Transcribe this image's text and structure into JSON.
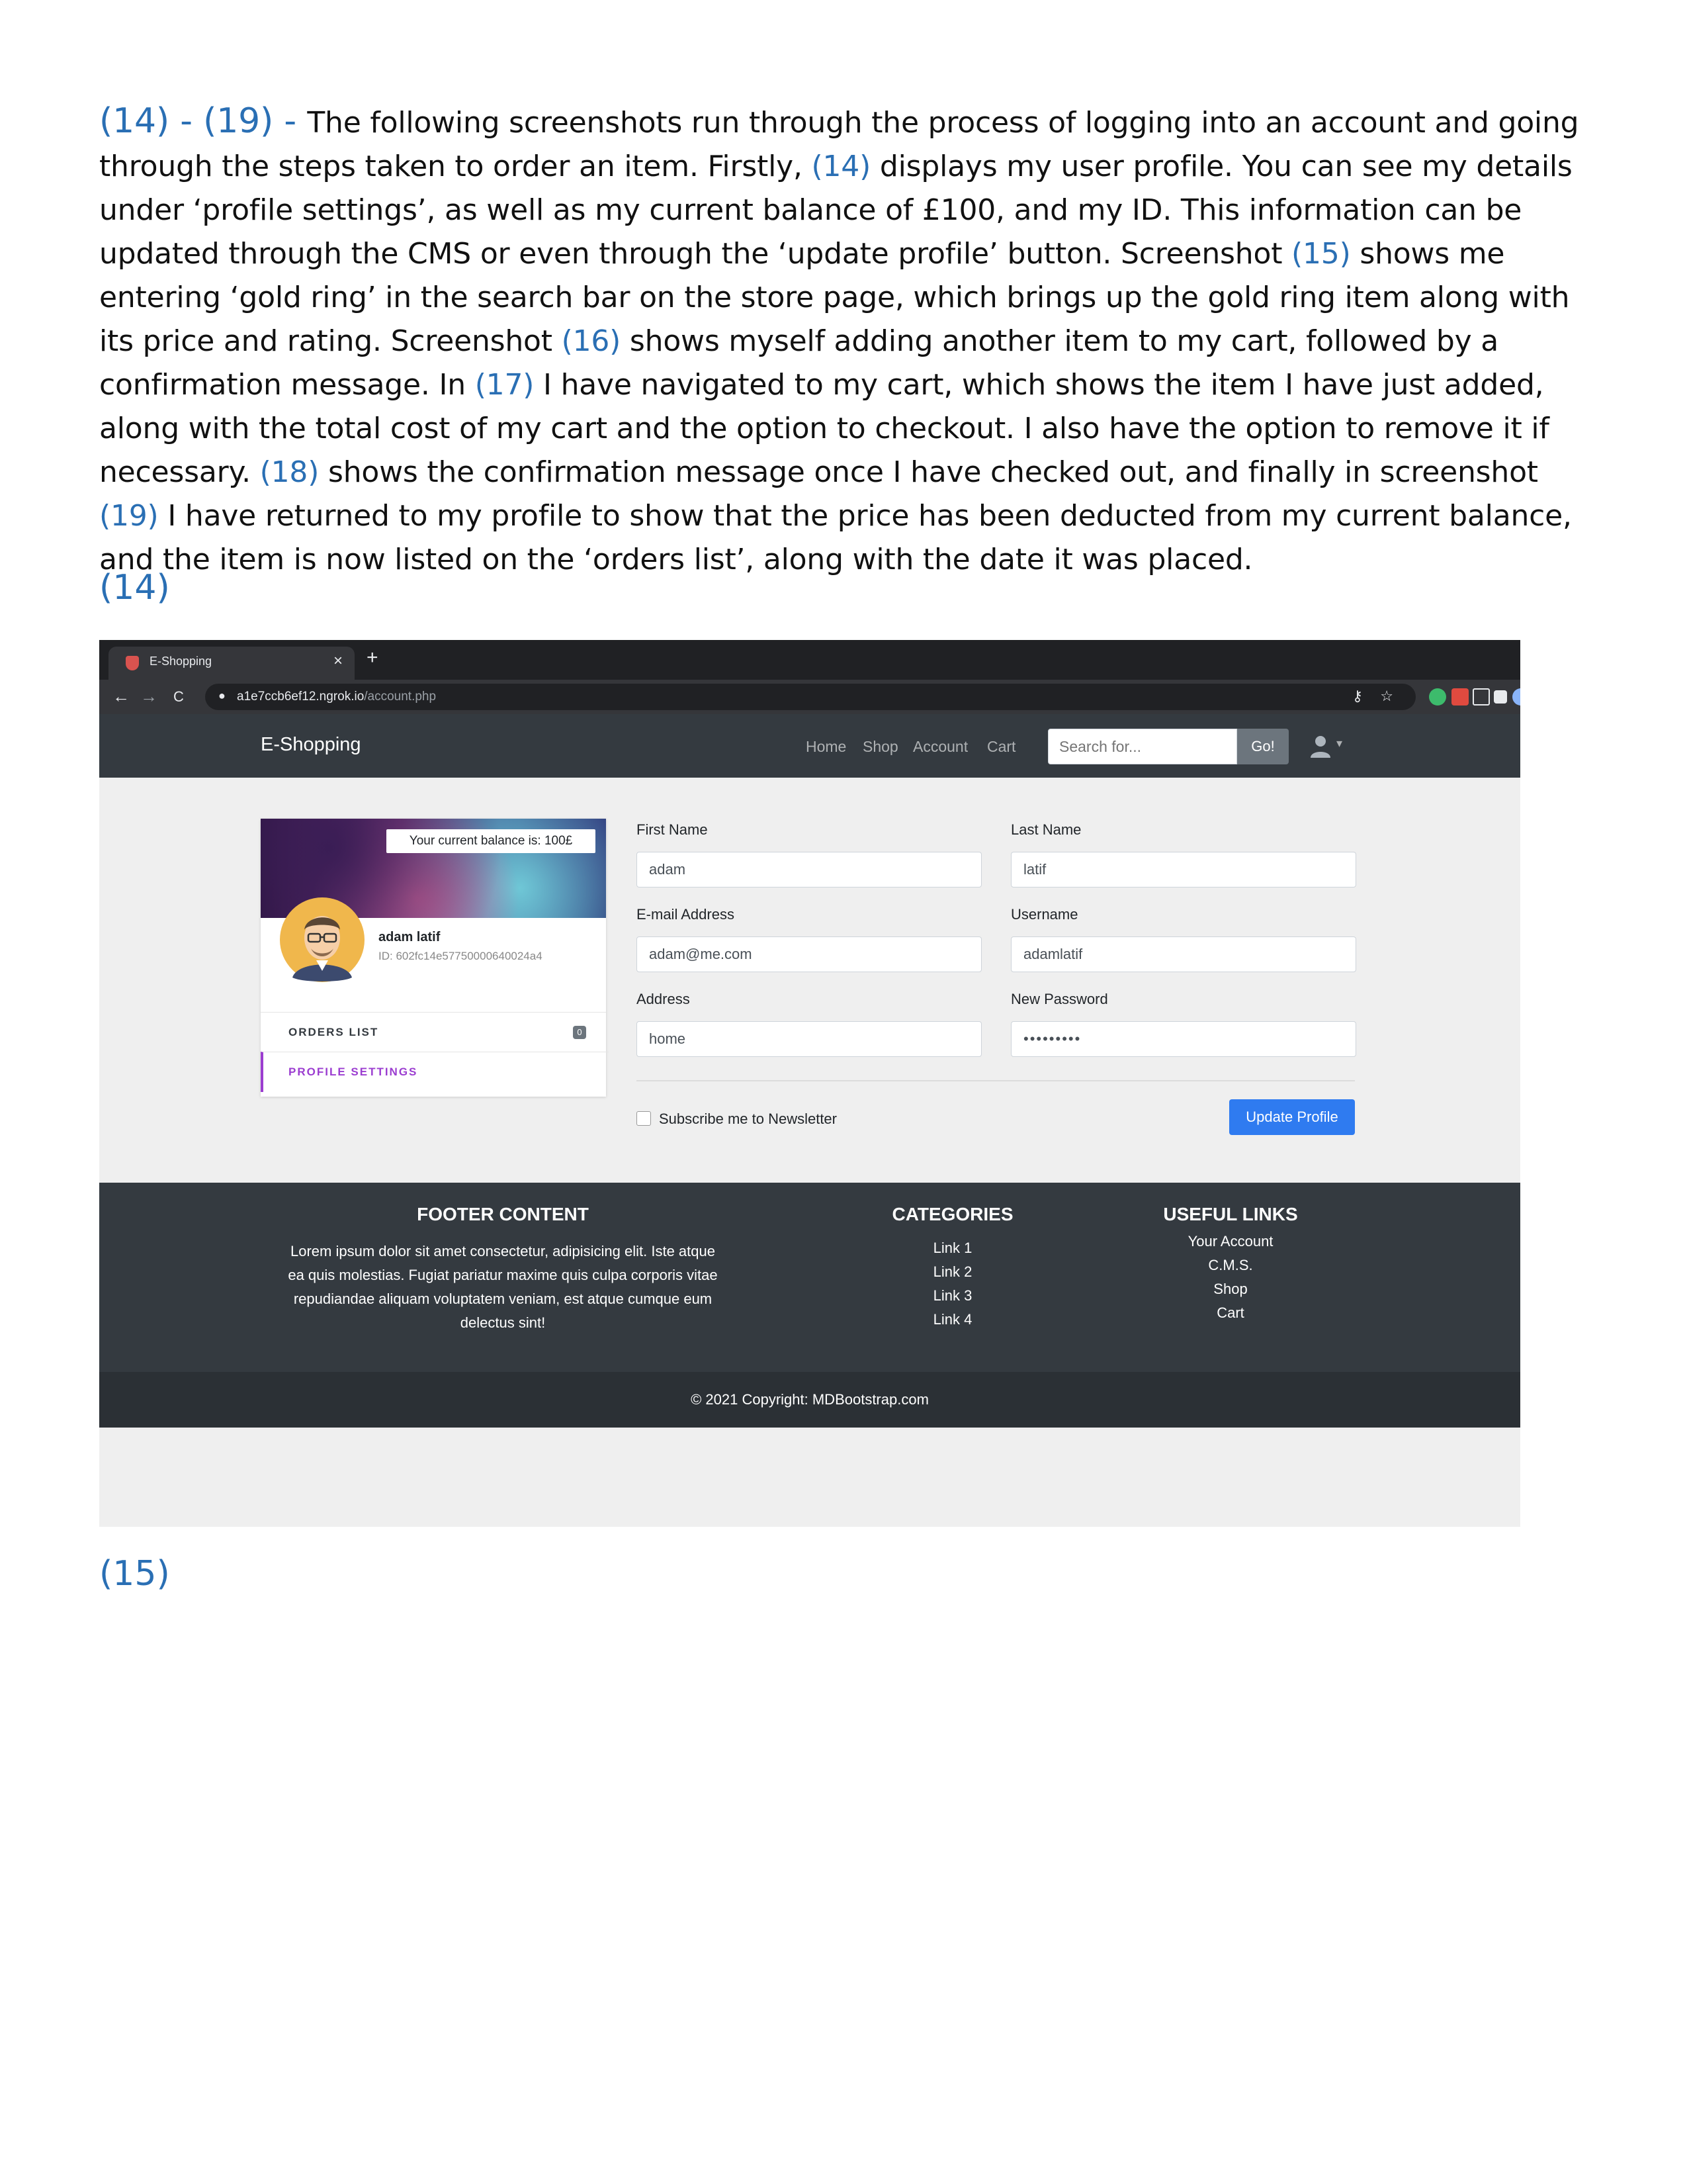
{
  "document": {
    "paragraph_parts": [
      {
        "text": "(14) - (19) - ",
        "ref": true,
        "lead": true
      },
      {
        "text": "The following screenshots run through the process of logging into an account and going through the steps taken to order an item. Firstly, ",
        "ref": false
      },
      {
        "text": "(14)",
        "ref": true
      },
      {
        "text": " displays my user profile. You can see my details under ‘profile settings’, as well as my current balance of £100, and my ID. This information can be updated through the CMS or even through the ‘update profile’ button. Screenshot ",
        "ref": false
      },
      {
        "text": "(15)",
        "ref": true
      },
      {
        "text": " shows me entering ‘gold ring’ in the search bar on the store page, which brings up the gold ring item along with its price and rating. Screenshot ",
        "ref": false
      },
      {
        "text": "(16)",
        "ref": true
      },
      {
        "text": " shows myself adding another item to my cart, followed by a confirmation message. In ",
        "ref": false
      },
      {
        "text": "(17)",
        "ref": true
      },
      {
        "text": " I have navigated to my cart, which shows the item I have just added, along with the total cost of my cart and the option to checkout. I also have the option to remove it if necessary. ",
        "ref": false
      },
      {
        "text": "(18)",
        "ref": true
      },
      {
        "text": " shows the confirmation message once I have checked out, and finally in screenshot ",
        "ref": false
      },
      {
        "text": "(19)",
        "ref": true
      },
      {
        "text": " I have returned to my profile to show that the price has been deducted from my current balance, and the item is now listed on the ‘orders list’, along with the date it was placed.",
        "ref": false
      }
    ],
    "label_14": "(14)",
    "label_15": "(15)",
    "ref_color": "#2a6fb4"
  },
  "browser": {
    "tab_title": "E-Shopping",
    "tab_close": "×",
    "new_tab": "+",
    "back": "←",
    "forward": "→",
    "reload": "C",
    "url_host": "a1e7ccb6ef12.ngrok.io",
    "url_path": "/account.php"
  },
  "navbar": {
    "brand": "E-Shopping",
    "links": [
      "Home",
      "Shop",
      "Account",
      "Cart"
    ],
    "search_placeholder": "Search for...",
    "go_label": "Go!"
  },
  "profile": {
    "balance": "Your current balance is: 100£",
    "name": "adam latif",
    "id": "ID: 602fc14e57750000640024a4",
    "orders_label": "ORDERS LIST",
    "orders_count": "0",
    "settings_label": "PROFILE SETTINGS",
    "accent": "#9b3dd0"
  },
  "form": {
    "first_name_label": "First Name",
    "first_name": "adam",
    "last_name_label": "Last Name",
    "last_name": "latif",
    "email_label": "E-mail Address",
    "email": "adam@me.com",
    "username_label": "Username",
    "username": "adamlatif",
    "address_label": "Address",
    "address": "home",
    "password_label": "New Password",
    "password": "•••••••••",
    "newsletter_label": "Subscribe me to Newsletter",
    "update_label": "Update Profile",
    "primary_color": "#2f7bf0"
  },
  "footer": {
    "content_title": "FOOTER CONTENT",
    "content_text": "Lorem ipsum dolor sit amet consectetur, adipisicing elit. Iste atque ea quis molestias. Fugiat pariatur maxime quis culpa corporis vitae repudiandae aliquam voluptatem veniam, est atque cumque eum delectus sint!",
    "categories_title": "CATEGORIES",
    "categories": [
      "Link 1",
      "Link 2",
      "Link 3",
      "Link 4"
    ],
    "useful_title": "USEFUL LINKS",
    "useful": [
      "Your Account",
      "C.M.S.",
      "Shop",
      "Cart"
    ],
    "copyright": "© 2021 Copyright: MDBootstrap.com"
  }
}
